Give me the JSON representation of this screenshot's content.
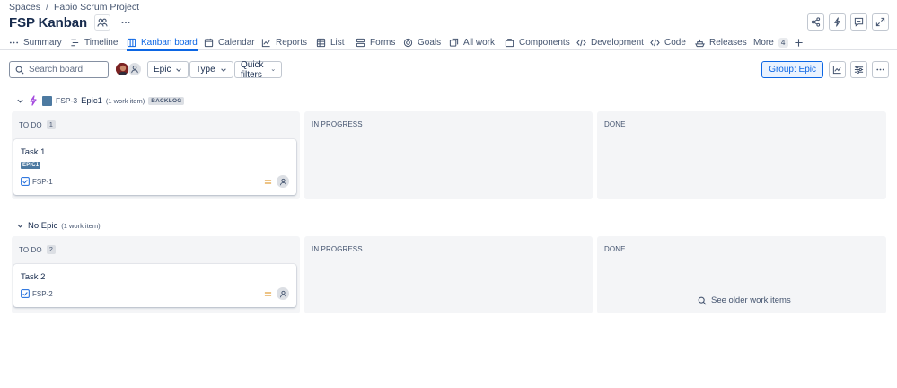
{
  "breadcrumbs": {
    "item1": "Spaces",
    "separator": "/",
    "item2": "Fabio Scrum Project"
  },
  "title": "FSP Kanban",
  "tabs": [
    {
      "label": "Summary",
      "icon": "dots-icon"
    },
    {
      "label": "Timeline",
      "icon": "timeline-icon"
    },
    {
      "label": "Kanban board",
      "icon": "board-icon"
    },
    {
      "label": "Calendar",
      "icon": "calendar-icon"
    },
    {
      "label": "Reports",
      "icon": "chart-icon"
    },
    {
      "label": "List",
      "icon": "list-icon"
    },
    {
      "label": "Forms",
      "icon": "forms-icon"
    },
    {
      "label": "Goals",
      "icon": "target-icon"
    },
    {
      "label": "All work",
      "icon": "stack-icon"
    },
    {
      "label": "Components",
      "icon": "component-icon"
    },
    {
      "label": "Development",
      "icon": "angle-brackets-icon"
    },
    {
      "label": "Code",
      "icon": "code-icon"
    },
    {
      "label": "Releases",
      "icon": "ship-icon"
    },
    {
      "label": "More",
      "badge": "4"
    }
  ],
  "toolbar": {
    "search_placeholder": "Search board",
    "epic_filter": "Epic",
    "type_filter": "Type",
    "quick_filters": "Quick filters",
    "group_button": "Group: Epic"
  },
  "swimlanes": [
    {
      "key": "FSP-3",
      "name": "Epic1",
      "count": "(1 work item)",
      "status": "BACKLOG",
      "columns": [
        {
          "title": "TO DO",
          "count": "1"
        },
        {
          "title": "IN PROGRESS"
        },
        {
          "title": "DONE"
        }
      ],
      "cards": [
        {
          "title": "Task 1",
          "epic": "EPIC1",
          "key": "FSP-1"
        }
      ]
    },
    {
      "name": "No Epic",
      "count": "(1 work item)",
      "columns": [
        {
          "title": "TO DO",
          "count": "2"
        },
        {
          "title": "IN PROGRESS"
        },
        {
          "title": "DONE"
        }
      ],
      "cards": [
        {
          "title": "Task 2",
          "key": "FSP-2"
        }
      ]
    }
  ],
  "see_older": "See older work items",
  "colors": {
    "accent": "#0c66e4",
    "epic": "#4d7aa1",
    "priority": "#e2a03f",
    "column_bg": "#f4f5f7"
  }
}
